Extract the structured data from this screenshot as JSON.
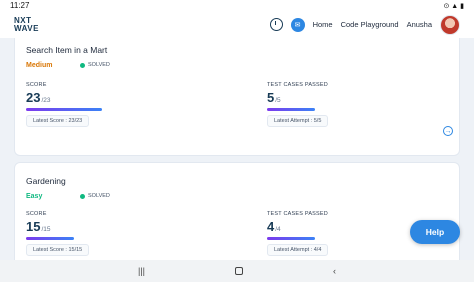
{
  "status_bar": {
    "time": "11:27",
    "icons": "⊙ ▲ ▮"
  },
  "header": {
    "logo_line1": "NXT",
    "logo_line2": "WAVE",
    "nav": [
      "Home",
      "Code Playground"
    ],
    "user_name": "Anusha"
  },
  "cards": [
    {
      "title": "Search Item in a Mart",
      "difficulty": "Medium",
      "difficulty_color": "#d97706",
      "status": "SOLVED",
      "score_label": "SCORE",
      "score": "23",
      "score_total": "/23",
      "score_fill": 1.0,
      "latest_score": "Latest Score : 23/23",
      "tests_label": "TEST CASES PASSED",
      "tests": "5",
      "tests_total": "/5",
      "tests_fill": 1.0,
      "latest_attempt": "Latest Attempt : 5/5"
    },
    {
      "title": "Gardening",
      "difficulty": "Easy",
      "difficulty_color": "#10b981",
      "status": "SOLVED",
      "score_label": "SCORE",
      "score": "15",
      "score_total": "/15",
      "score_fill": 1.0,
      "latest_score": "Latest Score : 15/15",
      "tests_label": "TEST CASES PASSED",
      "tests": "4",
      "tests_total": "/4",
      "tests_fill": 1.0,
      "latest_attempt": "Latest Attempt : 4/4"
    }
  ],
  "help_label": "Help",
  "nav_bar": {
    "recents": "|||",
    "back": "‹"
  },
  "colors": {
    "accent": "#2d87e2",
    "brand": "#183b56"
  }
}
